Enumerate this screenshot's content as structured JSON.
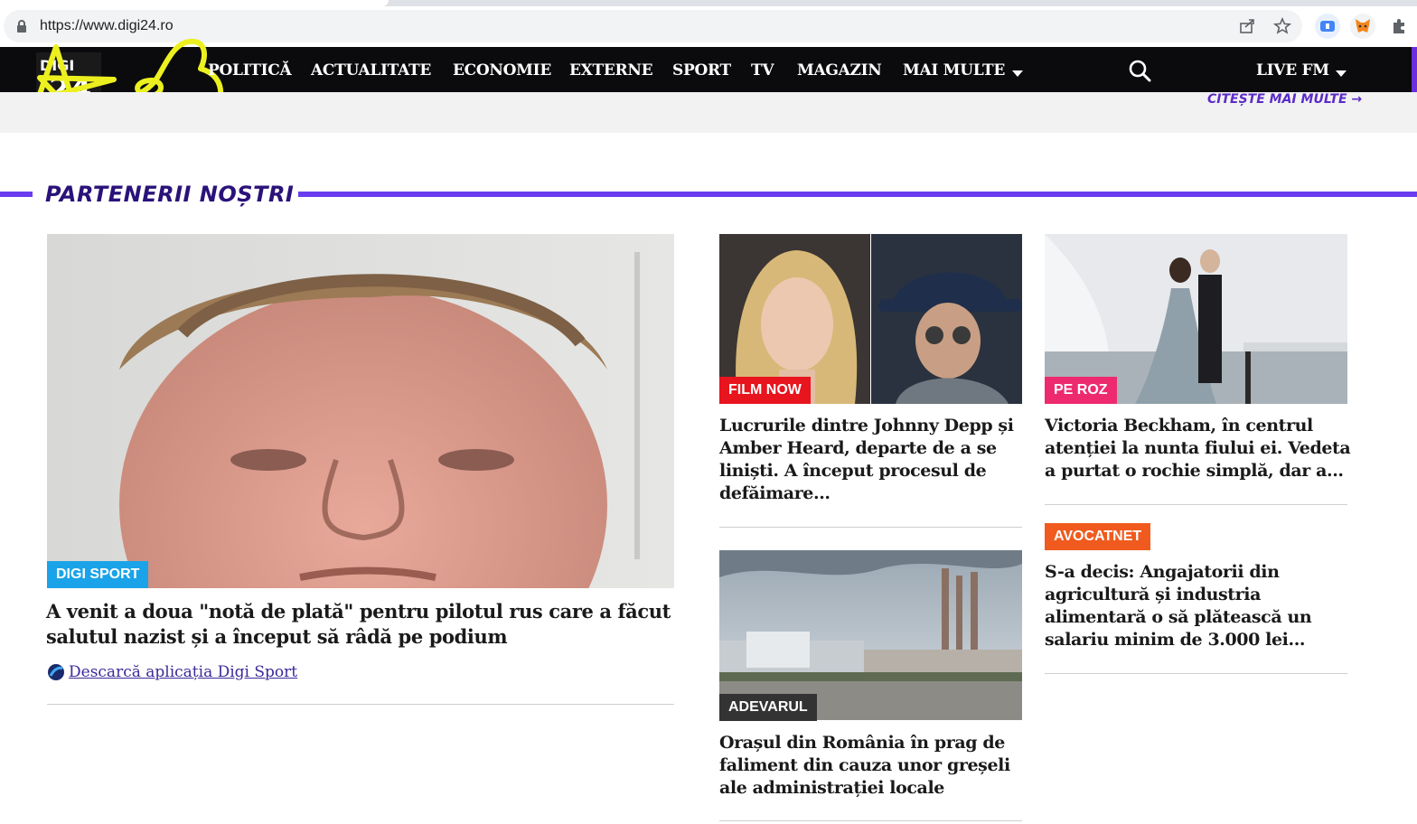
{
  "browser": {
    "url": "https://www.digi24.ro",
    "icons": [
      "lock-icon",
      "share-icon",
      "star-icon",
      "extension-icon",
      "metamask-icon",
      "puzzle-icon"
    ]
  },
  "nav": {
    "logo_text": "DIGI 24 HD",
    "items": [
      "POLITICĂ",
      "ACTUALITATE",
      "ECONOMIE",
      "EXTERNE",
      "SPORT",
      "TV",
      "MAGAZIN",
      "MAI MULTE"
    ],
    "live_label": "LIVE FM"
  },
  "strip": {
    "read_more": "CITEȘTE MAI MULTE →"
  },
  "section": {
    "title": "PARTENERII NOȘTRI"
  },
  "articles": [
    {
      "badge": "DIGI SPORT",
      "badge_color": "#1aa3e8",
      "title": "A venit a doua \"notă de plată\" pentru pilotul rus care a făcut salutul nazist și a început să râdă pe podium",
      "link": "Descarcă aplicația Digi Sport"
    },
    {
      "badge": "FILM NOW",
      "badge_color": "#e8141e",
      "title": "Lucrurile dintre Johnny Depp și Amber Heard, departe de a se liniști. A început procesul de defăimare..."
    },
    {
      "badge": "PE ROZ",
      "badge_color": "#ee2a6e",
      "title": "Victoria Beckham, în centrul atenției la nunta fiului ei. Vedeta a purtat o rochie simplă, dar a..."
    },
    {
      "badge": "ADEVARUL",
      "badge_color": "#333333",
      "title": "Orașul din România în prag de faliment din cauza unor greșeli ale administrației locale"
    },
    {
      "badge": "AVOCATNET",
      "badge_color": "#f05a1e",
      "title": "S-a decis: Angajatorii din agricultură și industria alimentară o să plătească un salariu minim de 3.000 lei..."
    }
  ]
}
